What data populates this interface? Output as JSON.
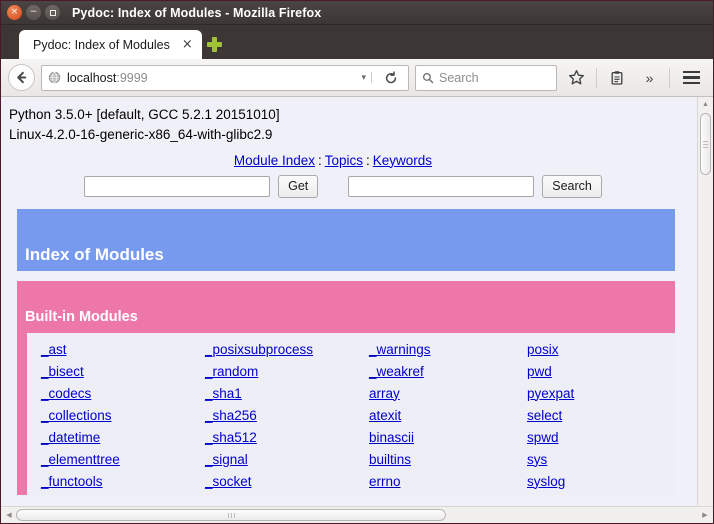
{
  "window": {
    "title": "Pydoc: Index of Modules - Mozilla Firefox",
    "controls": {
      "close": "×",
      "minimize": "−",
      "maximize": "□"
    }
  },
  "tabs": {
    "active": {
      "label": "Pydoc: Index of Modules",
      "close": "×"
    },
    "new_tab_label": "+"
  },
  "toolbar": {
    "back_label": "←",
    "url_host": "localhost",
    "url_port": ":9999",
    "url_caret": "▾",
    "reload_label": "⟳",
    "search_placeholder": "Search",
    "bookmark_label": "☆",
    "library_label": "▤",
    "overflow_label": "»",
    "menu_label": "≡"
  },
  "page": {
    "python_version": "Python 3.5.0+ [default, GCC 5.2.1 20151010]",
    "platform": "Linux-4.2.0-16-generic-x86_64-with-glibc2.9",
    "nav": [
      {
        "label": "Module Index"
      },
      {
        "label": "Topics"
      },
      {
        "label": "Keywords"
      }
    ],
    "nav_separator": ":",
    "get_form": {
      "value": "",
      "button": "Get"
    },
    "search_form": {
      "value": "",
      "button": "Search"
    },
    "heading": "Index of Modules",
    "section_heading": "Built-in Modules",
    "colors": {
      "blue_band": "#7799ee",
      "pink_band": "#ee77aa",
      "link": "#0000cc",
      "page_bg": "#f0f0f8"
    },
    "modules": {
      "col1": [
        "_ast",
        "_bisect",
        "_codecs",
        "_collections",
        "_datetime",
        "_elementtree",
        "_functools"
      ],
      "col2": [
        "_posixsubprocess",
        "_random",
        "_sha1",
        "_sha256",
        "_sha512",
        "_signal",
        "_socket"
      ],
      "col3": [
        "_warnings",
        "_weakref",
        "array",
        "atexit",
        "binascii",
        "builtins",
        "errno"
      ],
      "col4": [
        "posix",
        "pwd",
        "pyexpat",
        "select",
        "spwd",
        "sys",
        "syslog"
      ]
    }
  }
}
